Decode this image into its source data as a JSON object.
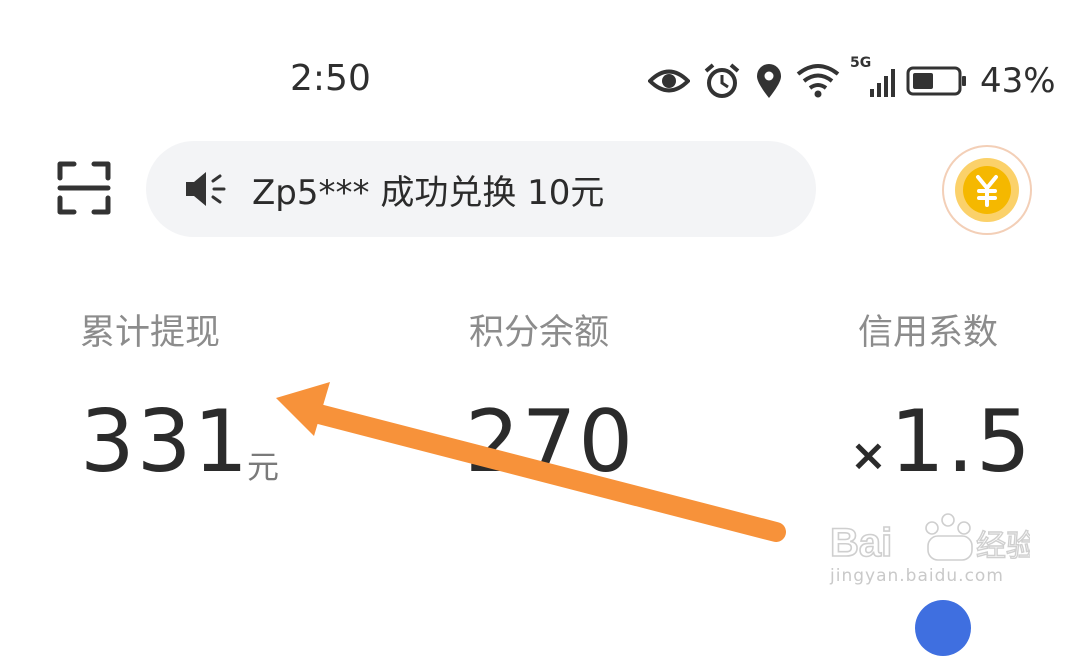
{
  "status_bar": {
    "time": "2:50",
    "network": "5G",
    "battery_percent": "43%",
    "icons": [
      "eye-icon",
      "alarm-icon",
      "location-icon",
      "wifi-icon",
      "signal-icon",
      "battery-icon"
    ]
  },
  "header": {
    "ticker_text": "Zp5*** 成功兑换 10元",
    "icons": [
      "scan-icon",
      "speaker-icon",
      "yuan-coin-icon"
    ]
  },
  "stats": [
    {
      "label": "累计提现",
      "value": "331",
      "unit": "元"
    },
    {
      "label": "积分余额",
      "value": "270"
    },
    {
      "label": "信用系数",
      "prefix": "×",
      "value": "1.5"
    }
  ],
  "colors": {
    "annotation_arrow": "#f7923a",
    "ticker_bg": "#f3f4f6",
    "coin": "#f5b800"
  },
  "watermark": {
    "brand": "Baidu 经验",
    "url": "jingyan.baidu.com"
  }
}
